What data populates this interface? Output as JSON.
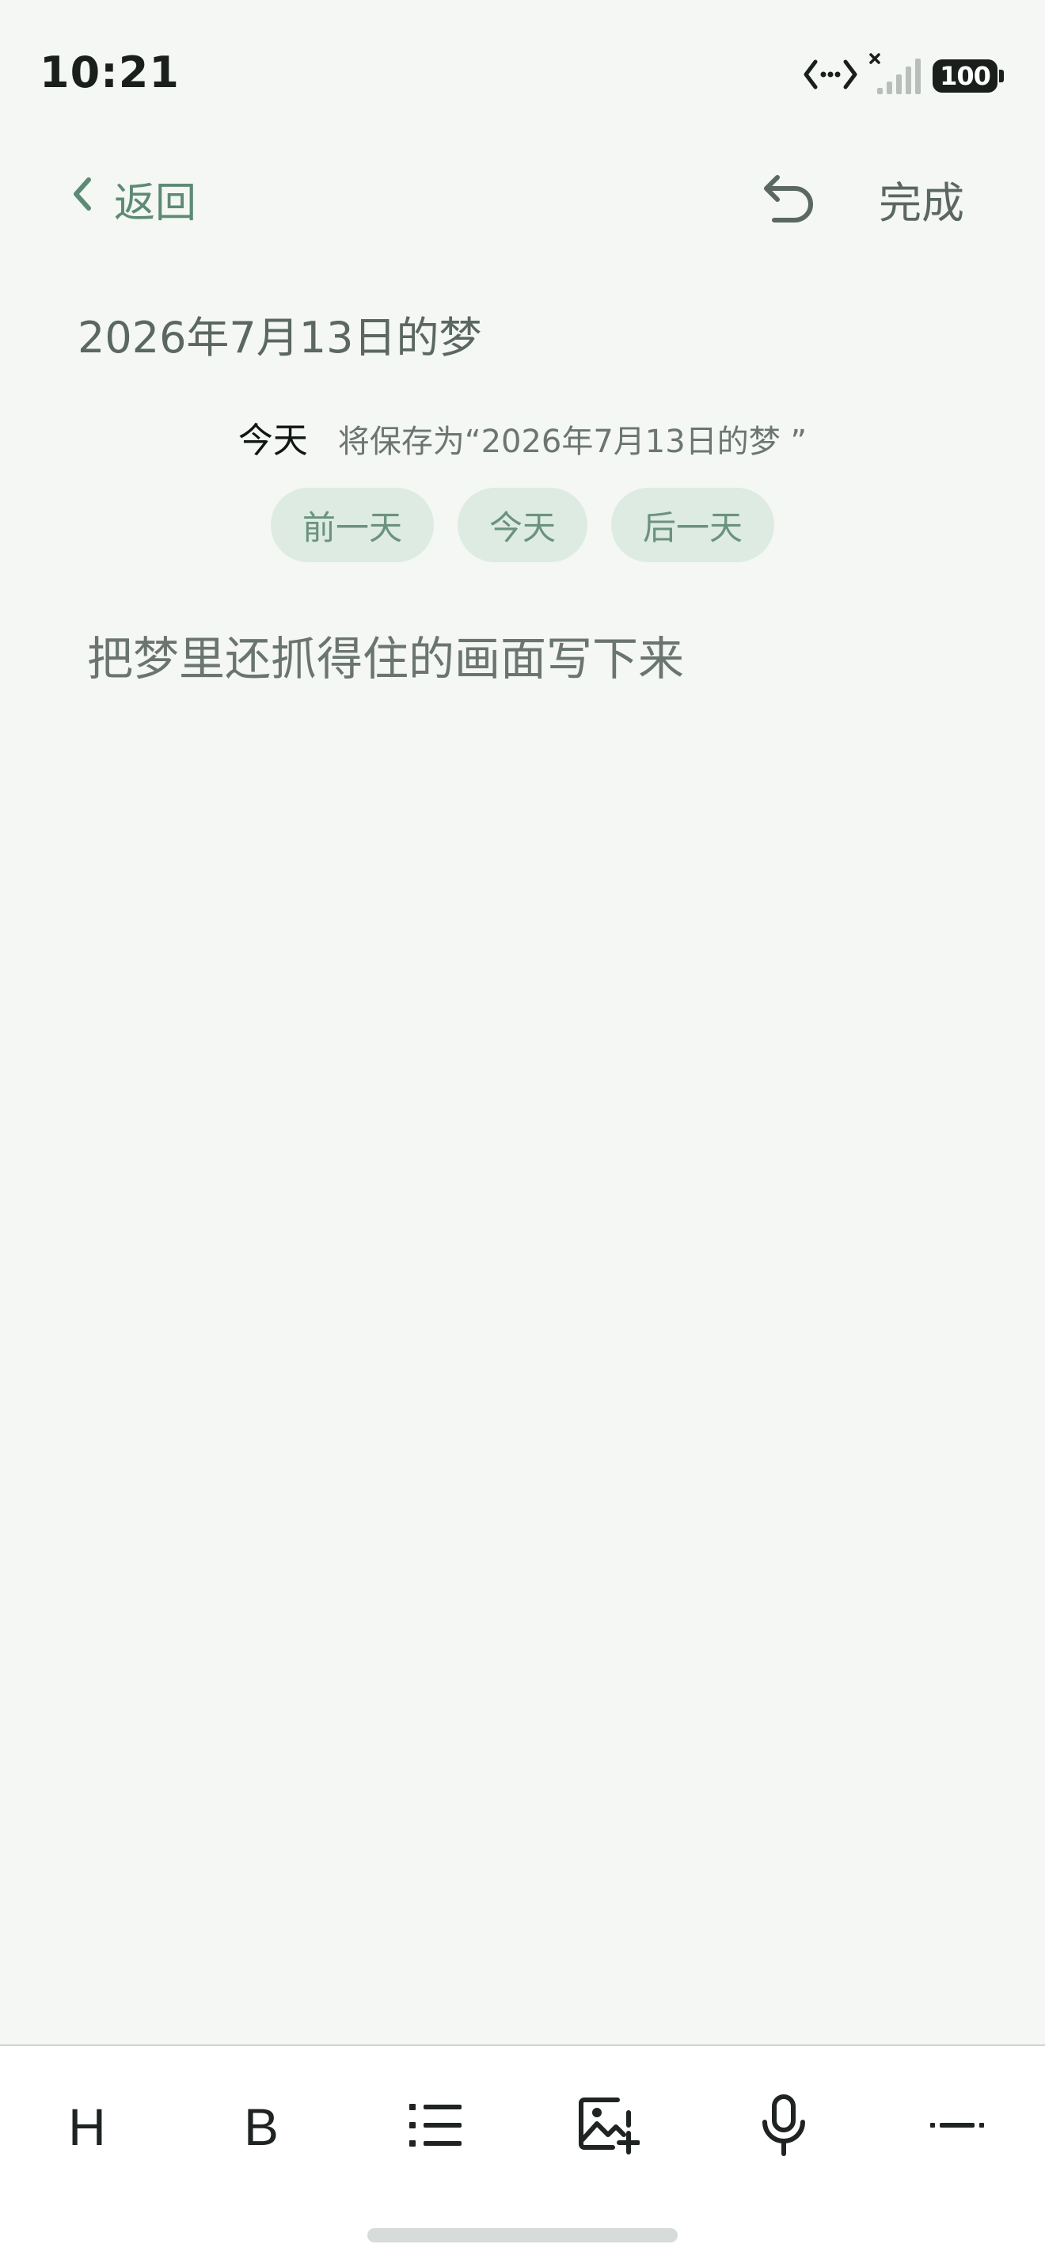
{
  "status_bar": {
    "time": "10:21",
    "battery": "100",
    "icons": [
      "data-transfer-icon",
      "no-signal-icon",
      "battery-icon"
    ]
  },
  "header": {
    "back_label": "返回",
    "done_label": "完成",
    "icons": [
      "chevron-left-icon",
      "undo-icon"
    ]
  },
  "note": {
    "title": "2026年7月13日的梦",
    "date_current": "今天",
    "save_hint": "将保存为“2026年7月13日的梦 ”",
    "chips": [
      "前一天",
      "今天",
      "后一天"
    ],
    "editor_placeholder": "把梦里还抓得住的画面写下来",
    "editor_value": ""
  },
  "toolbar": {
    "heading_label": "H",
    "bold_label": "B",
    "icons": [
      "heading-icon",
      "bold-icon",
      "bullet-list-icon",
      "add-image-icon",
      "microphone-icon",
      "divider-icon"
    ]
  },
  "colors": {
    "background": "#f4f7f3",
    "accent": "#5d8a76",
    "chip_background": "#ddebe3",
    "chip_text": "#6b927f",
    "text_primary": "#111513",
    "text_secondary": "#5b6761"
  }
}
